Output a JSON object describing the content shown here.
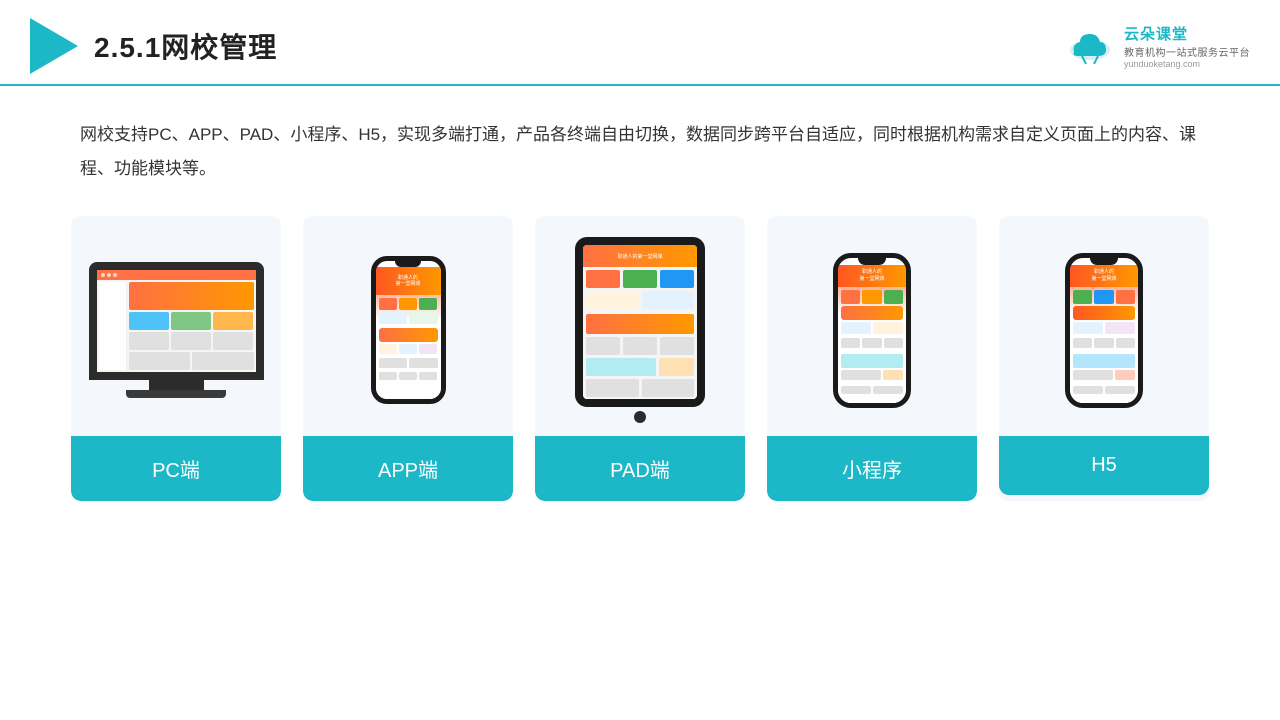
{
  "header": {
    "section_num": "2.5.1",
    "title": "网校管理",
    "logo_main": "云朵课堂",
    "logo_url": "yunduoketang.com",
    "logo_sub": "教育机构一站\n式服务云平台"
  },
  "description": {
    "text": "网校支持PC、APP、PAD、小程序、H5，实现多端打通，产品各终端自由切换，数据同步跨平台自适应，同时根据机构需求自定义页面上的内容、课程、功能模块等。"
  },
  "cards": [
    {
      "id": "pc",
      "label": "PC端"
    },
    {
      "id": "app",
      "label": "APP端"
    },
    {
      "id": "pad",
      "label": "PAD端"
    },
    {
      "id": "miniprogram",
      "label": "小程序"
    },
    {
      "id": "h5",
      "label": "H5"
    }
  ]
}
